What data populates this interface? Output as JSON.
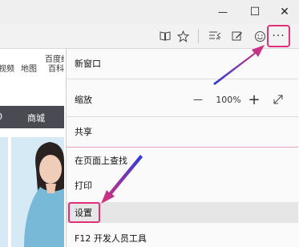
{
  "window": {
    "minimize_glyph": "—",
    "maximize_glyph": "☐",
    "close_glyph": "✕"
  },
  "toolbar": {
    "reading_view_icon": "book-icon",
    "favorite_icon": "star-icon",
    "hub_icon": "hub-icon",
    "note_icon": "pen-icon",
    "feedback_icon": "smiley-icon",
    "more_glyph": "···"
  },
  "page": {
    "links": [
      "视频",
      "地图",
      "百度经",
      "百科"
    ],
    "nav": [
      "0",
      "商城"
    ]
  },
  "menu": {
    "new_window": "新窗口",
    "zoom_label": "缩放",
    "zoom_minus": "—",
    "zoom_value": "100%",
    "zoom_plus": "+",
    "fullscreen_icon": "expand-icon",
    "share": "共享",
    "find": "在页面上查找",
    "print": "打印",
    "settings": "设置",
    "devtools": "F12 开发人员工具"
  },
  "colors": {
    "highlight": "#e0307a",
    "arrow_start": "#2a3bd8",
    "arrow_end": "#e0307a"
  }
}
